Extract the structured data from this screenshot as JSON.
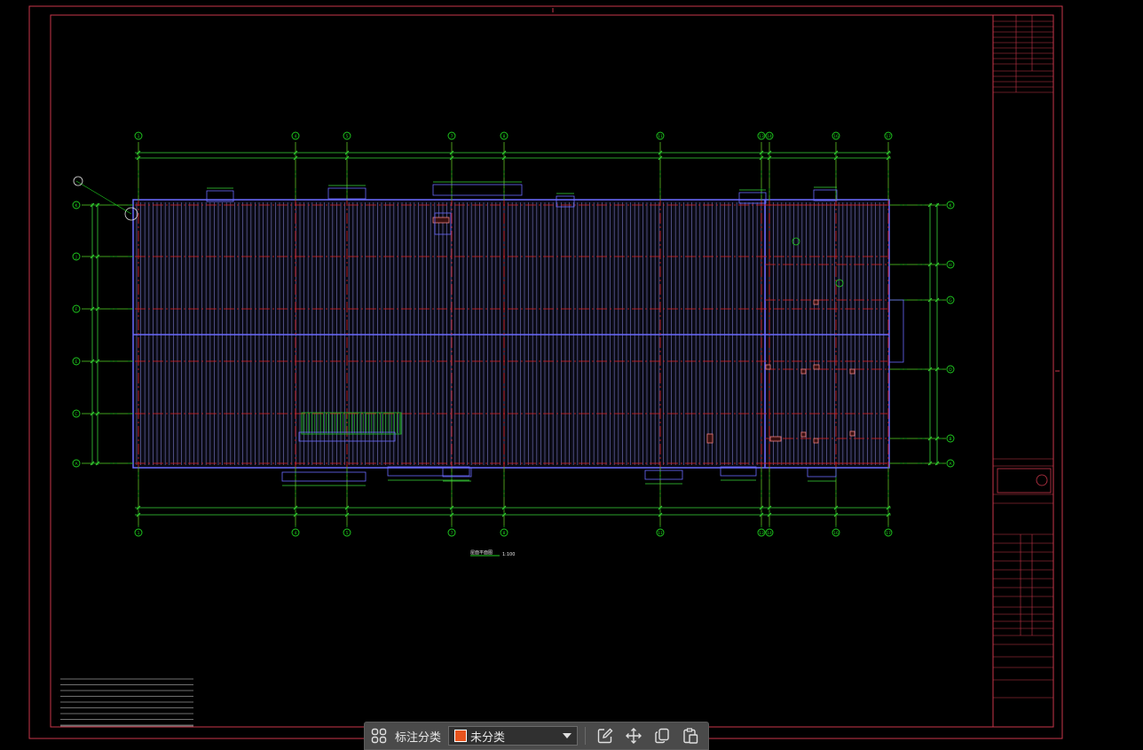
{
  "drawing": {
    "title_label": "屋面平面图",
    "scale_label": "1:100"
  },
  "grid_axes": {
    "columns": [
      "1",
      "4",
      "5",
      "7",
      "8",
      "11",
      "13",
      "14",
      "16",
      "17"
    ],
    "rows": [
      "K",
      "J",
      "F",
      "E",
      "C",
      "A"
    ],
    "right_rows": [
      "K",
      "H",
      "G",
      "D",
      "B",
      "A"
    ]
  },
  "toolbar": {
    "category_label": "标注分类",
    "selected_category": "未分类",
    "swatch_color": "#e8541e"
  },
  "colors": {
    "frame": "#c8364a",
    "grid": "#1fcf1f",
    "axis": "#e01f1f",
    "outline": "#6b6bff",
    "dim": "#39d439",
    "marker": "#f07f7f"
  }
}
